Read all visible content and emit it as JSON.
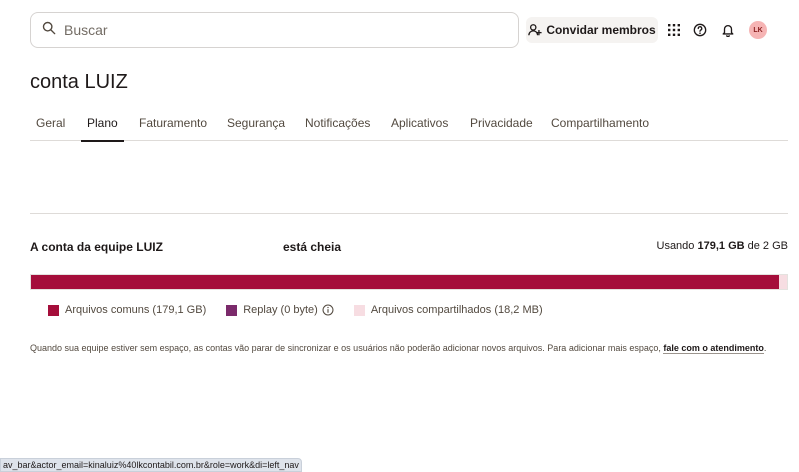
{
  "search": {
    "placeholder": "Buscar"
  },
  "header": {
    "invite_label": "Convidar membros",
    "avatar_initials": "LK"
  },
  "page": {
    "title": "conta LUIZ"
  },
  "tabs": [
    {
      "label": "Geral"
    },
    {
      "label": "Plano"
    },
    {
      "label": "Faturamento"
    },
    {
      "label": "Segurança"
    },
    {
      "label": "Notificações"
    },
    {
      "label": "Aplicativos"
    },
    {
      "label": "Privacidade"
    },
    {
      "label": "Compartilhamento"
    }
  ],
  "active_tab": "Plano",
  "storage": {
    "team_label": "A conta da equipe LUIZ",
    "status_label": "está cheia",
    "usage_prefix": "Usando ",
    "usage_used": "179,1 GB",
    "usage_suffix": " de 2 GB",
    "fill_fractions": {
      "common": 0.99,
      "replay": 0.0,
      "shared": 0.01
    },
    "legend": {
      "common": "Arquivos comuns (179,1 GB)",
      "replay": "Replay (0 byte)",
      "shared": "Arquivos compartilhados (18,2 MB)"
    },
    "note_text": "Quando sua equipe estiver sem espaço, as contas vão parar de sincronizar e os usuários não poderão adicionar novos arquivos. Para adicionar mais espaço, ",
    "note_link": "fale com o atendimento",
    "note_end": "."
  },
  "colors": {
    "common": "#a50e3b",
    "replay": "#7b2a6b",
    "shared": "#f7dde2"
  },
  "statusbar": {
    "url": "av_bar&actor_email=kinaluiz%40lkcontabil.com.br&role=work&di=left_nav"
  }
}
